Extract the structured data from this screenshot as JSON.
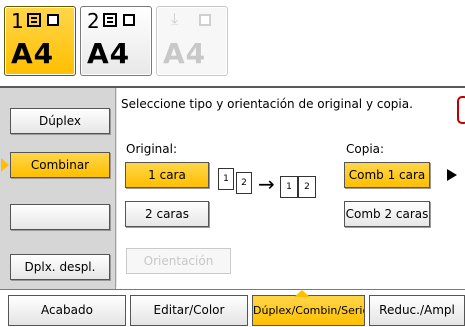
{
  "trays": [
    {
      "number": "1",
      "size": "A4",
      "state": "selected"
    },
    {
      "number": "2",
      "size": "A4",
      "state": "normal"
    },
    {
      "number": "",
      "size": "A4",
      "state": "disabled"
    }
  ],
  "sidebar": {
    "items": [
      {
        "label": "Dúplex"
      },
      {
        "label": "Combinar"
      },
      {
        "label": ""
      },
      {
        "label": "Dplx. despl."
      }
    ]
  },
  "main": {
    "instruction": "Seleccione tipo y orientación de original y copia.",
    "original_label": "Original:",
    "copy_label": "Copia:",
    "original_options": [
      "1 cara",
      "2 caras"
    ],
    "copy_options": [
      "Comb 1 cara",
      "Comb 2 caras"
    ],
    "orientation_label": "Orientación",
    "diagram": {
      "left_pages": [
        "1",
        "2"
      ],
      "right_pages": [
        "1",
        "2"
      ]
    }
  },
  "tabs": [
    {
      "label": "Acabado"
    },
    {
      "label": "Editar/Color"
    },
    {
      "label": "Dúplex/Combin/Serie"
    },
    {
      "label": "Reduc./Ampl"
    }
  ],
  "colors": {
    "accent": "#ffbf00",
    "alert": "#c00000"
  },
  "icons": {
    "tray": "paper-stack-icon",
    "bypass": "bypass-tray-icon",
    "next": "play-icon",
    "arrow": "arrow-right-icon"
  }
}
